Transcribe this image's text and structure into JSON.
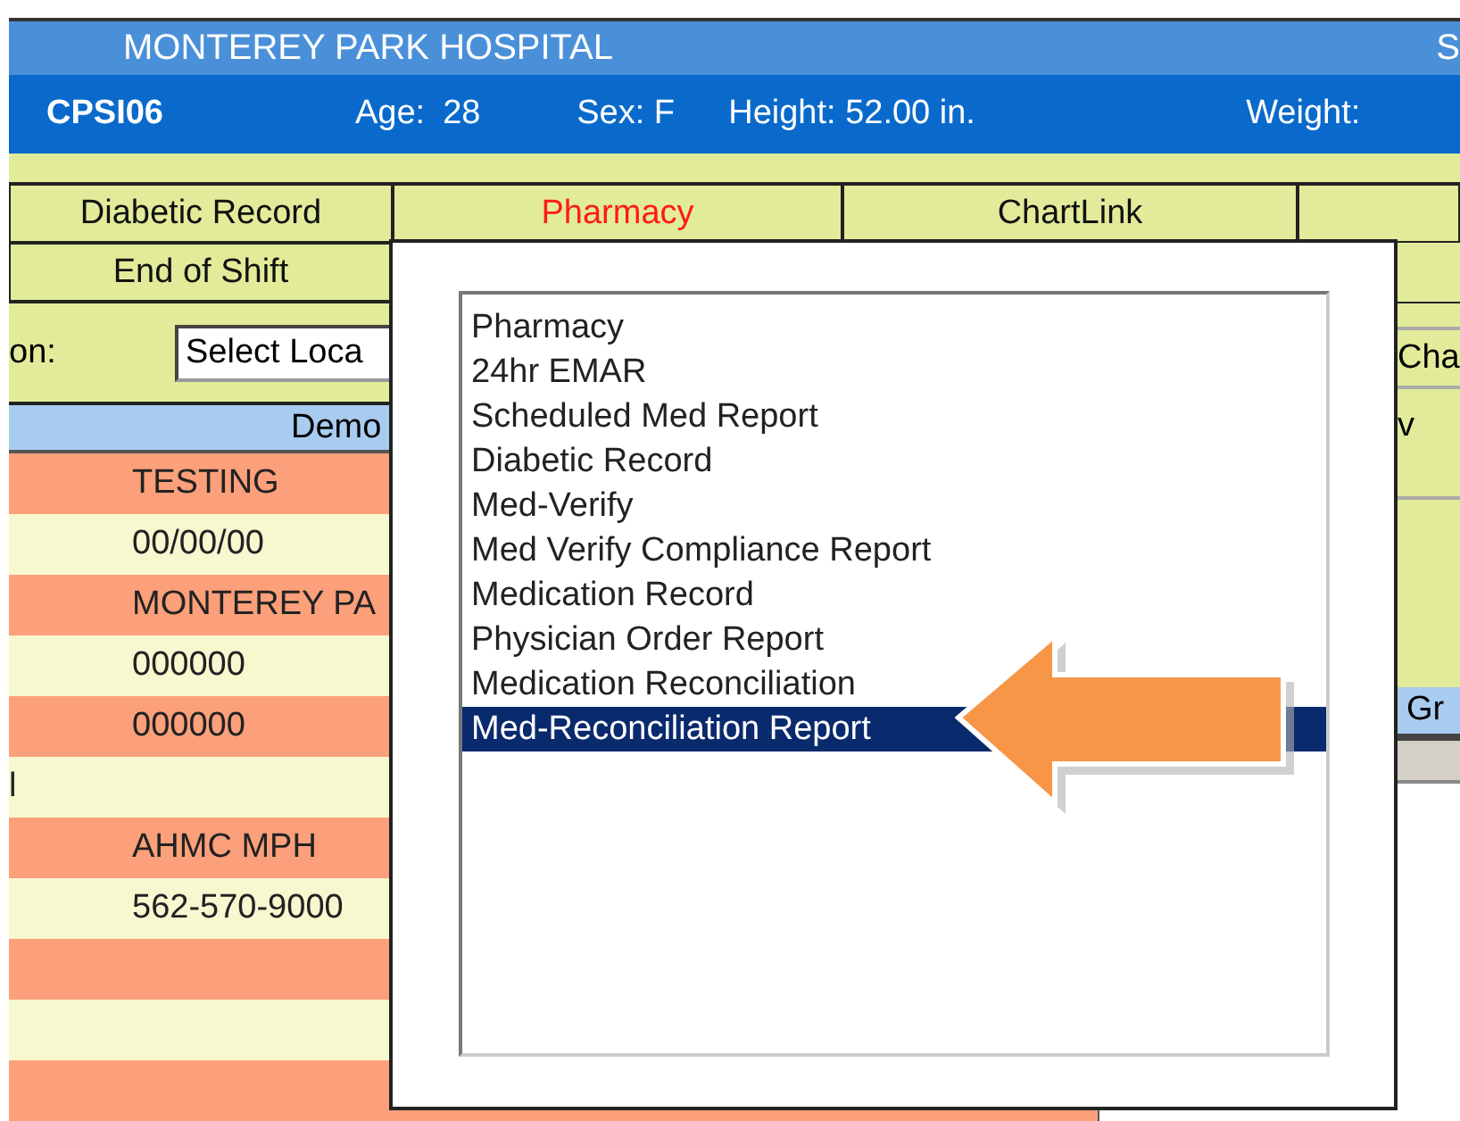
{
  "header": {
    "title": "MONTEREY PARK HOSPITAL",
    "title_right": "S"
  },
  "patient": {
    "id": "CPSI06",
    "age_label": "Age:",
    "age": "28",
    "sex": "Sex: F",
    "height": "Height: 52.00 in.",
    "weight_label": "Weight:"
  },
  "tabs": [
    {
      "label": "Diabetic Record",
      "selected": false
    },
    {
      "label": "Pharmacy",
      "selected": true
    },
    {
      "label": "ChartLink",
      "selected": false
    }
  ],
  "subtabs": [
    {
      "label": "End of Shift"
    }
  ],
  "location": {
    "label": "on:",
    "select_value": "Select Loca"
  },
  "right_panel": {
    "field_text": "Cha",
    "mark": "v",
    "header": "Gr"
  },
  "demographics": {
    "header": "Demo",
    "rows": [
      {
        "value": "TESTING"
      },
      {
        "value": "00/00/00"
      },
      {
        "value": "MONTEREY PA"
      },
      {
        "value": "000000"
      },
      {
        "value": "000000"
      },
      {
        "label": "l"
      },
      {
        "value": "AHMC MPH"
      },
      {
        "value": "562-570-9000"
      },
      {},
      {},
      {}
    ]
  },
  "menu": {
    "items": [
      {
        "label": "Pharmacy",
        "selected": false
      },
      {
        "label": "24hr EMAR",
        "selected": false
      },
      {
        "label": "Scheduled Med Report",
        "selected": false
      },
      {
        "label": "Diabetic Record",
        "selected": false
      },
      {
        "label": "Med-Verify",
        "selected": false
      },
      {
        "label": "Med Verify Compliance Report",
        "selected": false
      },
      {
        "label": "Medication Record",
        "selected": false
      },
      {
        "label": "Physician Order Report",
        "selected": false
      },
      {
        "label": "Medication Reconciliation",
        "selected": false
      },
      {
        "label": "Med-Reconciliation Report",
        "selected": true
      }
    ]
  }
}
